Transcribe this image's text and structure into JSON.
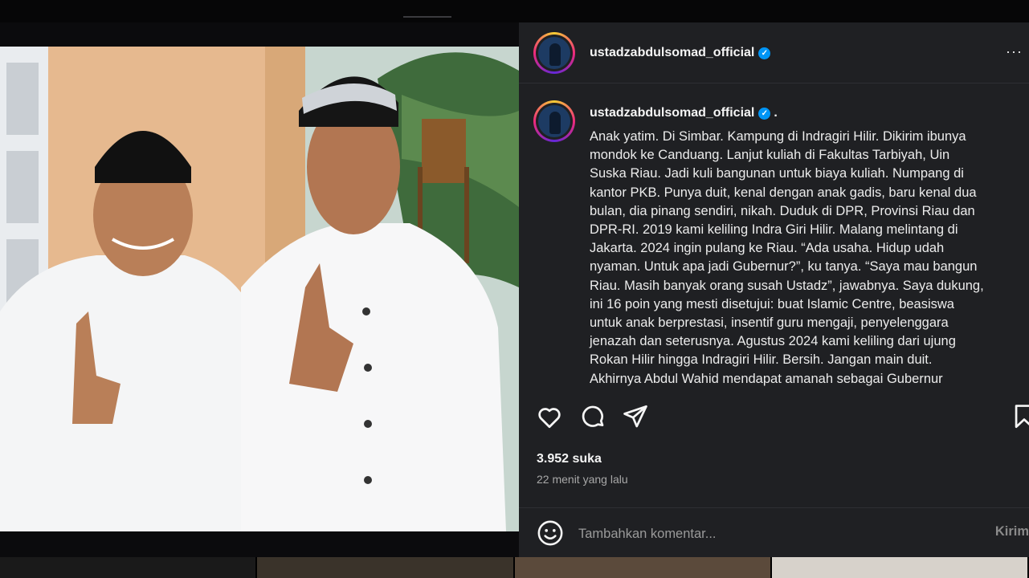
{
  "post": {
    "username": "ustadzabdulsomad_official",
    "caption_username": "ustadzabdulsomad_official",
    "caption_suffix": ".",
    "caption_lines": [
      "Anak yatim. Di Simbar. Kampung di Indragiri Hilir. Dikirim ibunya",
      "mondok ke Canduang. Lanjut kuliah di Fakultas Tarbiyah, Uin",
      "Suska Riau. Jadi kuli bangunan untuk biaya kuliah. Numpang di",
      "kantor PKB. Punya duit, kenal dengan anak gadis, baru kenal dua",
      "bulan, dia pinang sendiri, nikah. Duduk di DPR, Provinsi Riau dan",
      "DPR-RI. 2019 kami keliling Indra Giri Hilir. Malang melintang di",
      "Jakarta. 2024 ingin pulang ke Riau. “Ada usaha. Hidup udah",
      "nyaman. Untuk apa jadi Gubernur?”, ku tanya. “Saya mau bangun",
      "Riau. Masih banyak orang susah Ustadz”, jawabnya. Saya dukung,",
      "ini 16 poin yang mesti disetujui: buat Islamic Centre, beasiswa",
      "untuk anak berprestasi, insentif guru mengaji, penyelenggara",
      "jenazah dan seterusnya. Agustus 2024 kami keliling dari ujung",
      "Rokan Hilir hingga Indragiri Hilir. Bersih. Jangan main duit.",
      "Akhirnya Abdul Wahid mendapat amanah sebagai Gubernur"
    ],
    "likes": "3.952 suka",
    "time": "22 menit yang lalu",
    "comment_placeholder": "Tambahkan komentar...",
    "post_label": "Kirim"
  },
  "icons": {
    "verified": "verified-badge-icon",
    "more": "more-options-icon",
    "like": "heart-icon",
    "comment": "comment-bubble-icon",
    "share": "paper-plane-icon",
    "save": "bookmark-icon",
    "emoji": "emoji-icon"
  },
  "colors": {
    "panel_bg": "#1f2023",
    "verified_blue": "#0095f6",
    "muted_text": "#a8a8a8"
  }
}
